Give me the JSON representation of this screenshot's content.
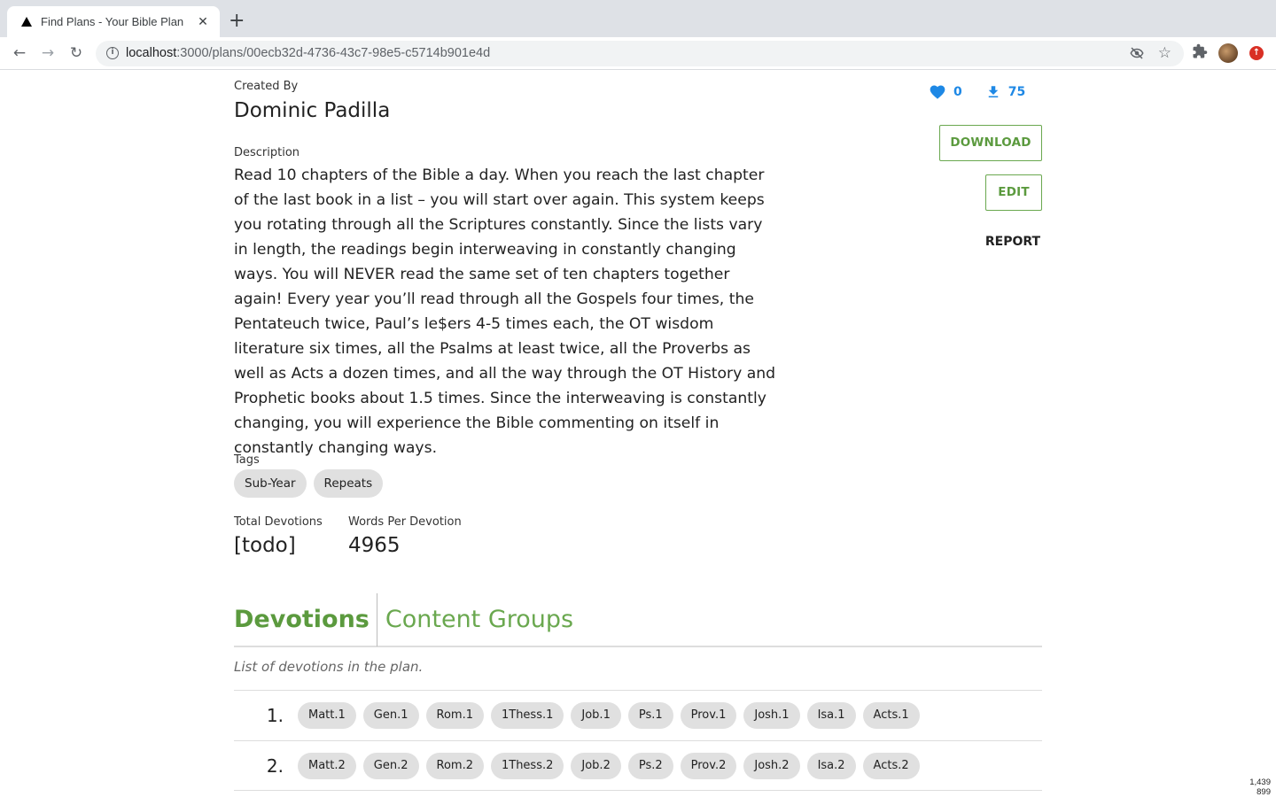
{
  "browser": {
    "tab_title": "Find Plans - Your Bible Plan",
    "tab_close": "✕",
    "new_tab": "+",
    "url_host": "localhost",
    "url_path": ":3000/plans/00ecb32d-4736-43c7-98e5-c5714b901e4d"
  },
  "plan": {
    "created_by_label": "Created By",
    "creator": "Dominic Padilla",
    "likes": "0",
    "downloads": "75",
    "download_button": "DOWNLOAD",
    "edit_button": "EDIT",
    "report_button": "REPORT",
    "description_label": "Description",
    "description": "Read 10 chapters of the Bible a day. When you reach the last chapter of the last book in a list – you will start over again. This system keeps you rotating through all the Scriptures constantly. Since the lists vary in length, the readings begin interweaving in constantly changing ways. You will NEVER read the same set of ten chapters together again! Every year you’ll read through all the Gospels four times, the Pentateuch twice, Paul’s le$ers 4-5 times each, the OT wisdom literature six times, all the Psalms at least twice, all the Proverbs as well as Acts a dozen times, and all the way through the OT History and Prophetic books about 1.5 times. Since the interweaving is constantly changing, you will experience the Bible commenting on itself in constantly changing ways.",
    "tags_label": "Tags",
    "tags": [
      "Sub-Year",
      "Repeats"
    ],
    "total_devotions_label": "Total Devotions",
    "total_devotions": "[todo]",
    "words_per_devotion_label": "Words Per Devotion",
    "words_per_devotion": "4965"
  },
  "tabs": {
    "devotions": "Devotions",
    "content_groups": "Content Groups"
  },
  "devotions": {
    "description": "List of devotions in the plan.",
    "rows": [
      {
        "number": "1.",
        "refs": [
          "Matt.1",
          "Gen.1",
          "Rom.1",
          "1Thess.1",
          "Job.1",
          "Ps.1",
          "Prov.1",
          "Josh.1",
          "Isa.1",
          "Acts.1"
        ]
      },
      {
        "number": "2.",
        "refs": [
          "Matt.2",
          "Gen.2",
          "Rom.2",
          "1Thess.2",
          "Job.2",
          "Ps.2",
          "Prov.2",
          "Josh.2",
          "Isa.2",
          "Acts.2"
        ]
      }
    ]
  },
  "corner_readout": {
    "width": "1,439",
    "height": "899"
  },
  "colors": {
    "accent_green": "#5b9a3e",
    "stat_blue": "#1e88e5"
  }
}
